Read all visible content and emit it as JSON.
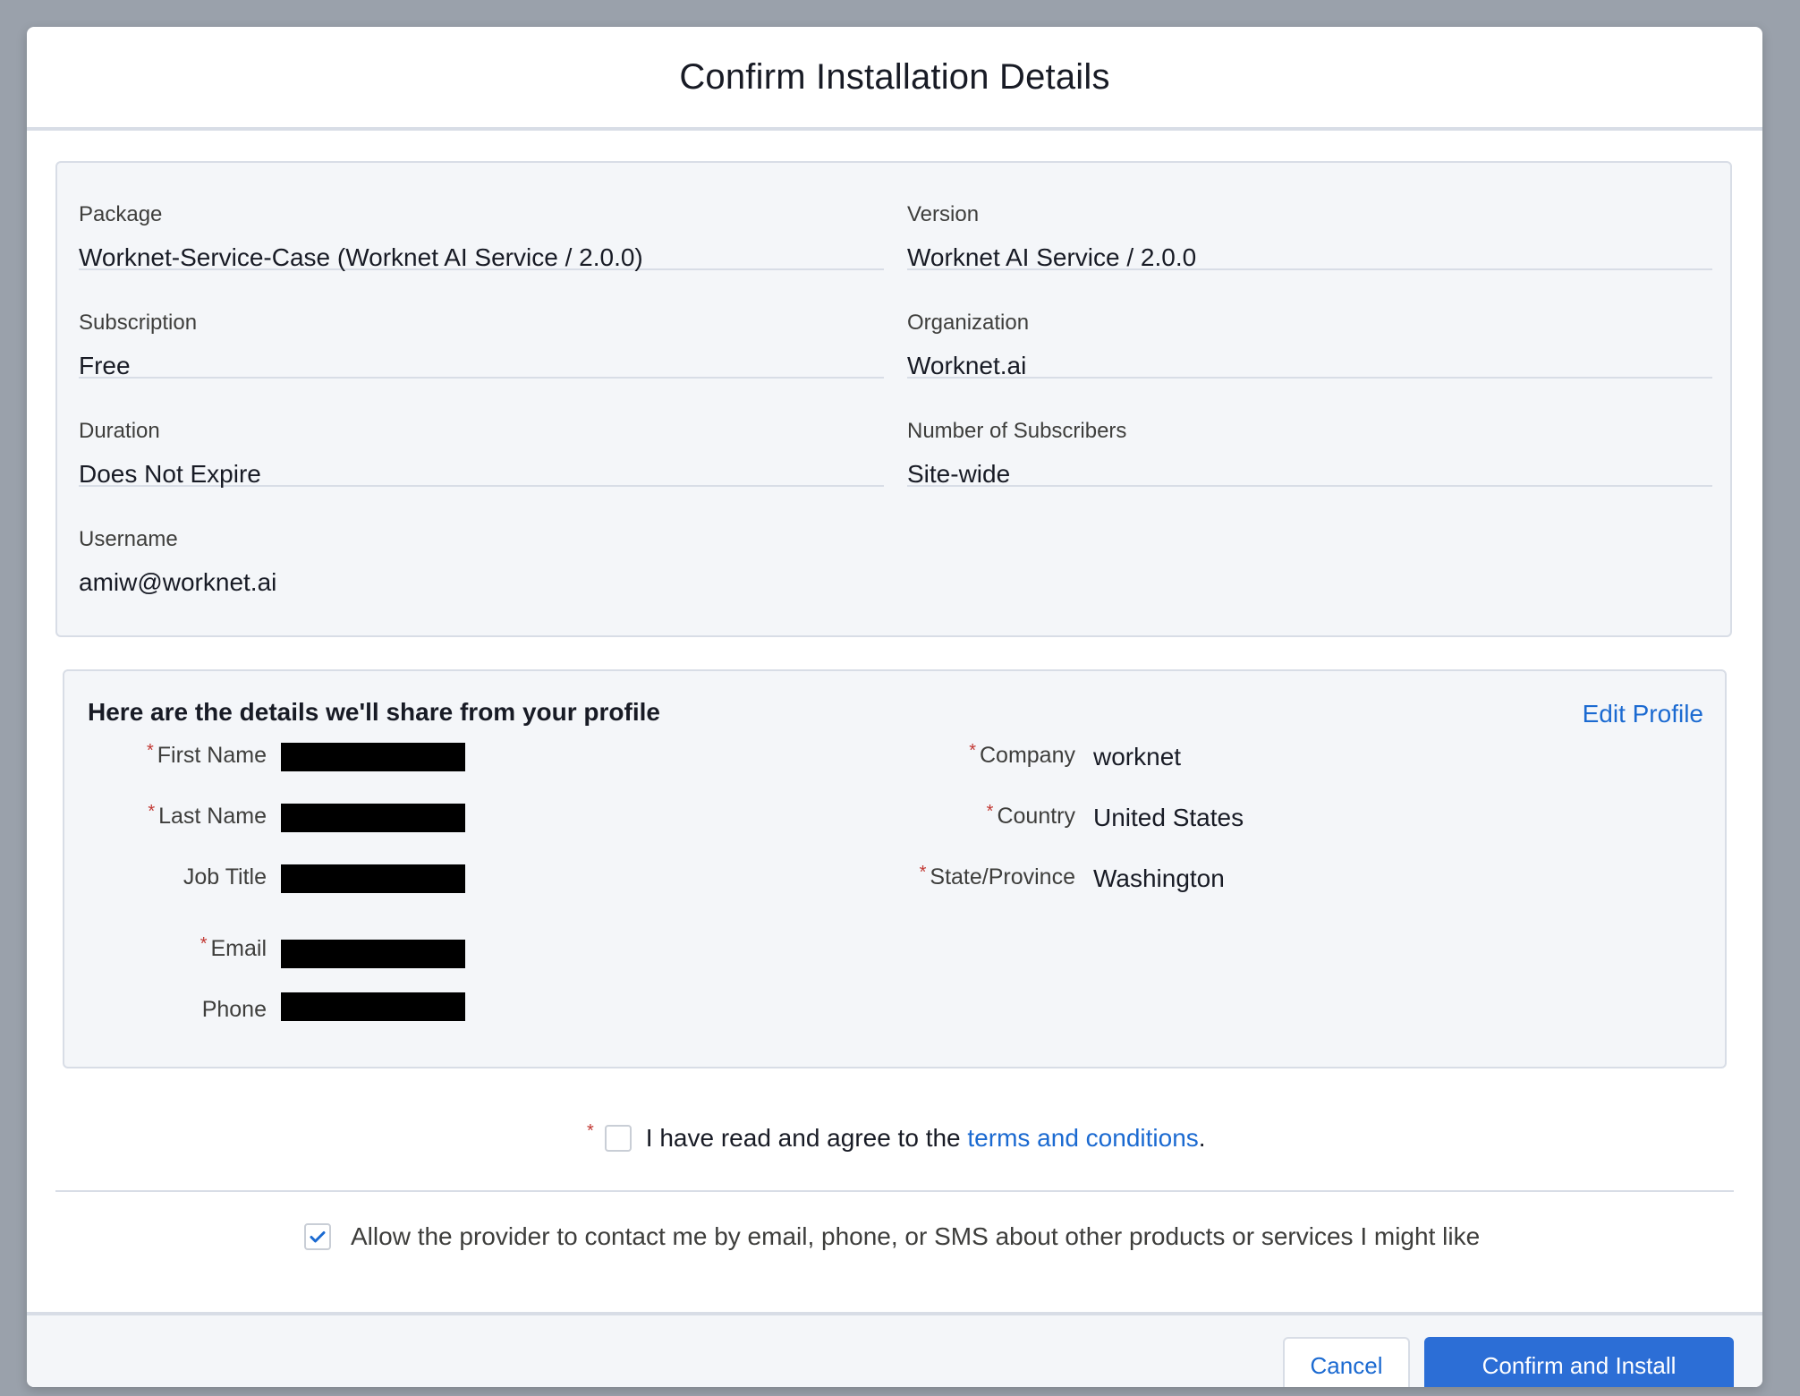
{
  "modal": {
    "title": "Confirm Installation Details"
  },
  "details": {
    "package_label": "Package",
    "package_value": "Worknet-Service-Case (Worknet AI Service / 2.0.0)",
    "version_label": "Version",
    "version_value": "Worknet AI Service / 2.0.0",
    "subscription_label": "Subscription",
    "subscription_value": "Free",
    "organization_label": "Organization",
    "organization_value": "Worknet.ai",
    "duration_label": "Duration",
    "duration_value": "Does Not Expire",
    "subscribers_label": "Number of Subscribers",
    "subscribers_value": "Site-wide",
    "username_label": "Username",
    "username_value": "amiw@worknet.ai"
  },
  "profile": {
    "heading": "Here are the details we'll share from your profile",
    "edit_link": "Edit Profile",
    "required_mark": "*",
    "first_name_label": "First Name",
    "last_name_label": "Last Name",
    "job_title_label": "Job Title",
    "email_label": "Email",
    "phone_label": "Phone",
    "company_label": "Company",
    "company_value": "worknet",
    "country_label": "Country",
    "country_value": "United States",
    "state_label": "State/Province",
    "state_value": "Washington"
  },
  "agreement": {
    "required_mark": "*",
    "text_before": "I have read and agree to the ",
    "link_text": "terms and conditions",
    "text_after": ".",
    "checked": false
  },
  "contact_consent": {
    "text": "Allow the provider to contact me by email, phone, or SMS about other products or services I might like",
    "checked": true
  },
  "footer": {
    "cancel_label": "Cancel",
    "confirm_label": "Confirm and Install"
  },
  "colors": {
    "accent": "#2c6ed6",
    "link": "#1b6ad1",
    "required": "#c23934",
    "overlay": "#9aa1ab"
  }
}
